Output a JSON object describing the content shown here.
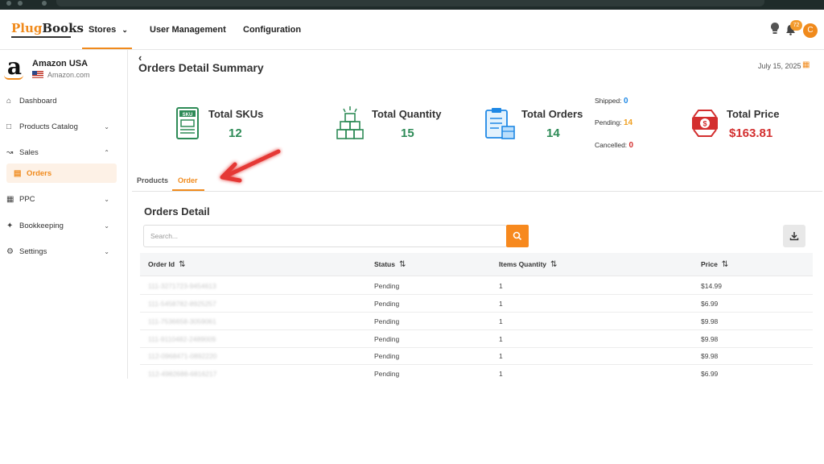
{
  "brand": {
    "logo_part1": "Plug",
    "logo_part2": "Books"
  },
  "nav": {
    "stores": "Stores",
    "user_management": "User Management",
    "configuration": "Configuration",
    "notification_count": "72",
    "avatar_letter": "C"
  },
  "store": {
    "name": "Amazon USA",
    "domain": "Amazon.com"
  },
  "sidebar": {
    "items": [
      {
        "label": "Dashboard",
        "icon": "home-icon"
      },
      {
        "label": "Products Catalog",
        "icon": "box-icon"
      },
      {
        "label": "Sales",
        "icon": "chart-icon"
      },
      {
        "label": "Orders",
        "icon": "document-icon"
      },
      {
        "label": "PPC",
        "icon": "card-icon"
      },
      {
        "label": "Bookkeeping",
        "icon": "puzzle-icon"
      },
      {
        "label": "Settings",
        "icon": "gear-icon"
      }
    ]
  },
  "page": {
    "title": "Orders Detail Summary",
    "date": "July 15, 2025"
  },
  "stats": {
    "skus": {
      "label": "Total SKUs",
      "value": "12"
    },
    "quantity": {
      "label": "Total Quantity",
      "value": "15"
    },
    "orders": {
      "label": "Total Orders",
      "value": "14"
    },
    "price": {
      "label": "Total Price",
      "value": "$163.81"
    }
  },
  "status": {
    "shipped_label": "Shipped:",
    "shipped": "0",
    "pending_label": "Pending:",
    "pending": "14",
    "cancelled_label": "Cancelled:",
    "cancelled": "0"
  },
  "tabs": {
    "products": "Products",
    "order": "Order"
  },
  "orders_detail": {
    "title": "Orders Detail",
    "search_placeholder": "Search...",
    "columns": [
      "Order Id",
      "Status",
      "Items Quantity",
      "Price"
    ],
    "rows": [
      {
        "id": "111-3271723-9454613",
        "status": "Pending",
        "qty": "1",
        "price": "$14.99"
      },
      {
        "id": "111-5458782-8925257",
        "status": "Pending",
        "qty": "1",
        "price": "$6.99"
      },
      {
        "id": "111-7536658-3059061",
        "status": "Pending",
        "qty": "1",
        "price": "$9.98"
      },
      {
        "id": "111-9110482-2489009",
        "status": "Pending",
        "qty": "1",
        "price": "$9.98"
      },
      {
        "id": "112-0968471-0892220",
        "status": "Pending",
        "qty": "1",
        "price": "$9.98"
      },
      {
        "id": "112-4982688-6816217",
        "status": "Pending",
        "qty": "1",
        "price": "$6.99"
      }
    ]
  },
  "colors": {
    "accent": "#f08a1c",
    "green": "#2e8b57",
    "red": "#d32f2f",
    "blue": "#1e88e5"
  }
}
